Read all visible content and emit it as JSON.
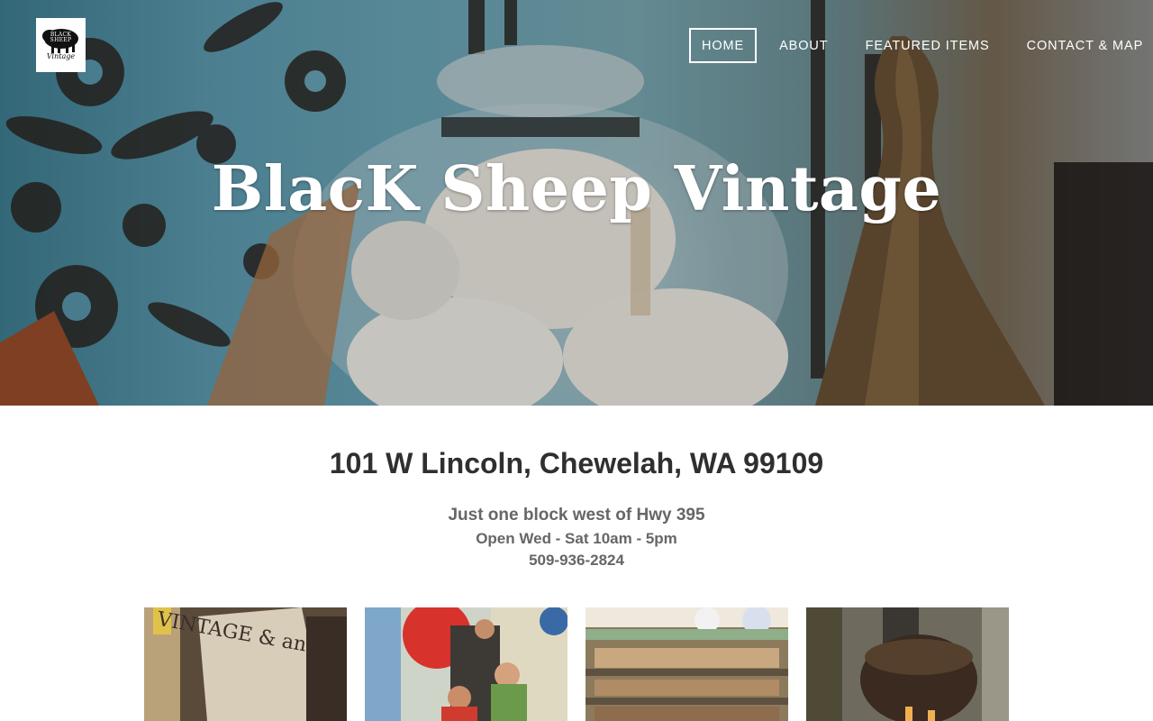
{
  "site": {
    "title": "BlacK Sheep Vintage",
    "logo_text_top": "BLACK SHEEP",
    "logo_text_bottom": "Vintage"
  },
  "nav": {
    "items": [
      {
        "label": "HOME",
        "active": true
      },
      {
        "label": "ABOUT",
        "active": false
      },
      {
        "label": "FEATURED ITEMS",
        "active": false
      },
      {
        "label": "CONTACT & MAP",
        "active": false
      }
    ]
  },
  "info": {
    "address": "101 W Lincoln, Chewelah, WA 99109",
    "directions": "Just one block west of Hwy 395",
    "hours": "Open Wed - Sat 10am - 5pm",
    "phone": "509-936-2824"
  },
  "gallery": {
    "photo1_sign": "VINTAGE & antiques"
  },
  "colors": {
    "accent": "#ffffff",
    "heading": "#2f2f2f",
    "subtext": "#666666"
  }
}
